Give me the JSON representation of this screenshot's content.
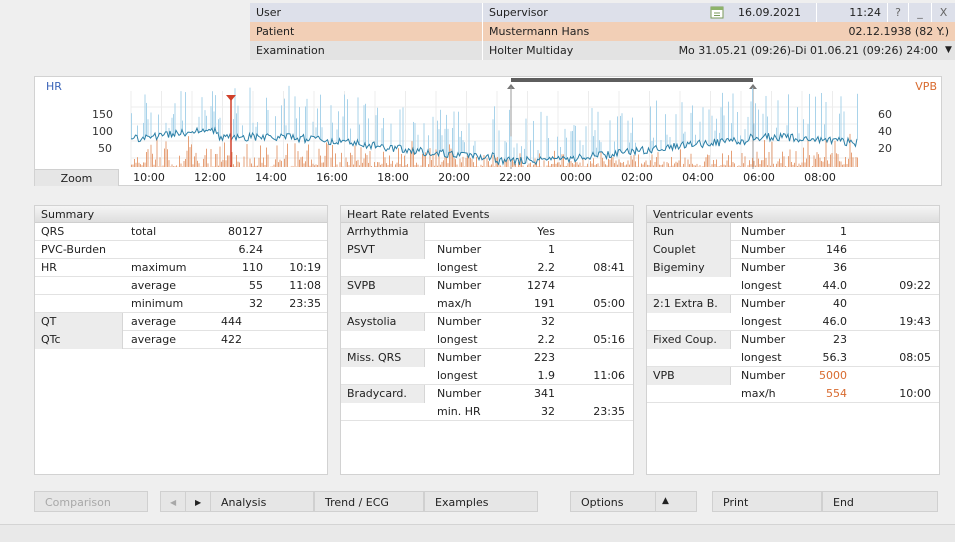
{
  "header": {
    "user_label": "User",
    "user_value": "Supervisor",
    "date": "16.09.2021",
    "time": "11:24",
    "help_glyph": "?",
    "minimize_glyph": "_",
    "close_glyph": "X",
    "patient_label": "Patient",
    "patient_name": "Mustermann Hans",
    "patient_birth": "02.12.1938 (82 Y.)",
    "exam_label": "Examination",
    "exam_type": "Holter  Multiday",
    "exam_period": "Mo 31.05.21 (09:26)-Di 01.06.21 (09:26) 24:00",
    "dropdown_glyph": "▼"
  },
  "chart": {
    "hr_title": "HR",
    "vpb_title": "VPB",
    "left_ticks": [
      "150",
      "100",
      "50"
    ],
    "right_ticks": [
      "60",
      "40",
      "20"
    ],
    "zoom_label": "Zoom",
    "time_ticks": [
      "10:00",
      "12:00",
      "14:00",
      "16:00",
      "18:00",
      "20:00",
      "22:00",
      "00:00",
      "02:00",
      "04:00",
      "06:00",
      "08:00"
    ],
    "hr_color": "#2b7fa6",
    "hr_range_color": "#a9d3ea",
    "vpb_color": "#e08a57",
    "marker_color": "#d0402a"
  },
  "summary": {
    "title": "Summary",
    "qrs_label": "QRS",
    "qrs_sub": "total",
    "qrs_value": "80127",
    "pvc_label": "PVC-Burden",
    "pvc_value": "6.24",
    "hr_label": "HR",
    "hr_max_label": "maximum",
    "hr_max_value": "110",
    "hr_max_time": "10:19",
    "hr_avg_label": "average",
    "hr_avg_value": "55",
    "hr_avg_time": "11:08",
    "hr_min_label": "minimum",
    "hr_min_value": "32",
    "hr_min_time": "23:35",
    "qt_label": "QT",
    "qt_sub": "average",
    "qt_value": "444",
    "qtc_label": "QTc",
    "qtc_sub": "average",
    "qtc_value": "422"
  },
  "hre": {
    "title": "Heart Rate related Events",
    "arrhythmia_label": "Arrhythmia",
    "arrhythmia_value": "Yes",
    "psvt_label": "PSVT",
    "psvt_number_label": "Number",
    "psvt_number": "1",
    "psvt_longest_label": "longest",
    "psvt_longest": "2.2",
    "psvt_longest_time": "08:41",
    "svpb_label": "SVPB",
    "svpb_number_label": "Number",
    "svpb_number": "1274",
    "svpb_maxh_label": "max/h",
    "svpb_maxh": "191",
    "svpb_maxh_time": "05:00",
    "asys_label": "Asystolia",
    "asys_number_label": "Number",
    "asys_number": "32",
    "asys_longest_label": "longest",
    "asys_longest": "2.2",
    "asys_longest_time": "05:16",
    "missqrs_label": "Miss. QRS",
    "missqrs_number_label": "Number",
    "missqrs_number": "223",
    "missqrs_longest_label": "longest",
    "missqrs_longest": "1.9",
    "missqrs_longest_time": "11:06",
    "brady_label": "Bradycard.",
    "brady_number_label": "Number",
    "brady_number": "341",
    "brady_minhr_label": "min. HR",
    "brady_minhr": "32",
    "brady_minhr_time": "23:35"
  },
  "vent": {
    "title": "Ventricular events",
    "run_label": "Run",
    "run_number_label": "Number",
    "run_number": "1",
    "couplet_label": "Couplet",
    "couplet_number_label": "Number",
    "couplet_number": "146",
    "bigeminy_label": "Bigeminy",
    "bigeminy_number_label": "Number",
    "bigeminy_number": "36",
    "bigeminy_longest_label": "longest",
    "bigeminy_longest": "44.0",
    "bigeminy_longest_time": "09:22",
    "extrab_label": "2:1 Extra B.",
    "extrab_number_label": "Number",
    "extrab_number": "40",
    "extrab_longest_label": "longest",
    "extrab_longest": "46.0",
    "extrab_longest_time": "19:43",
    "fixed_label": "Fixed Coup.",
    "fixed_number_label": "Number",
    "fixed_number": "23",
    "fixed_longest_label": "longest",
    "fixed_longest": "56.3",
    "fixed_longest_time": "08:05",
    "vpb_label": "VPB",
    "vpb_number_label": "Number",
    "vpb_number": "5000",
    "vpb_maxh_label": "max/h",
    "vpb_maxh": "554",
    "vpb_maxh_time": "10:00"
  },
  "toolbar": {
    "comparison": "Comparison",
    "prev_glyph": "◀",
    "next_glyph": "▶",
    "analysis": "Analysis",
    "trend": "Trend / ECG",
    "examples": "Examples",
    "options": "Options",
    "options_glyph": "▲",
    "print": "Print",
    "end": "End"
  }
}
